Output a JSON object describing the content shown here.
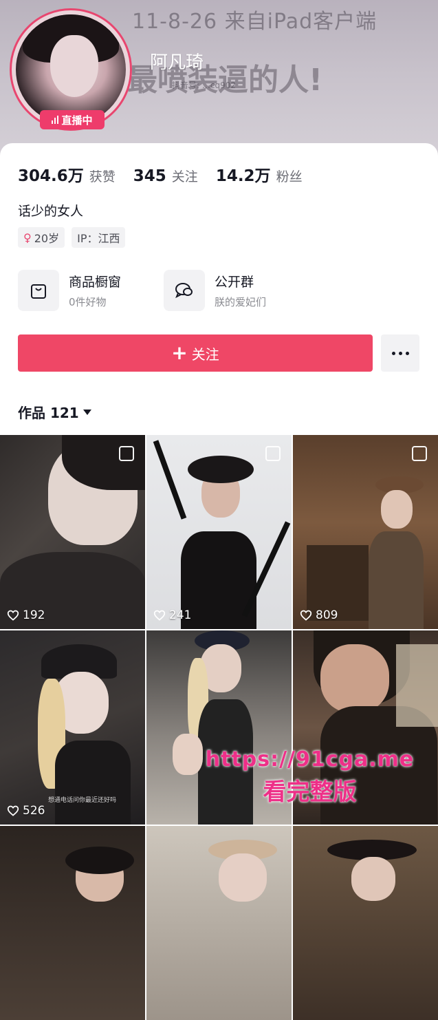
{
  "cover": {
    "line1": "11-8-26  来自iPad客户端",
    "line2": "最喷装逼的人!",
    "line3": "抖音号: …cq902"
  },
  "profile": {
    "nickname": "阿凡琦",
    "live_badge": "直播中",
    "stats": [
      {
        "value": "304.6万",
        "label": "获赞"
      },
      {
        "value": "345",
        "label": "关注"
      },
      {
        "value": "14.2万",
        "label": "粉丝"
      }
    ],
    "bio": "话少的女人",
    "tags": {
      "age": "20岁",
      "ip": "IP：江西"
    },
    "features": [
      {
        "title": "商品橱窗",
        "subtitle": "0件好物",
        "icon": "shopping-bag-icon"
      },
      {
        "title": "公开群",
        "subtitle": "朕的爱妃们",
        "icon": "group-chat-icon"
      }
    ],
    "follow_label": "关注",
    "works_label": "作品 121"
  },
  "grid": {
    "tiles": [
      {
        "likes": "192",
        "caption": ""
      },
      {
        "likes": "241",
        "caption": ""
      },
      {
        "likes": "809",
        "caption": ""
      },
      {
        "likes": "526",
        "caption": "想通电话问你最近还好吗"
      },
      {
        "likes": "",
        "caption": ""
      },
      {
        "likes": "",
        "caption": ""
      },
      {
        "likes": "",
        "caption": ""
      },
      {
        "likes": "",
        "caption": ""
      },
      {
        "likes": "",
        "caption": ""
      }
    ]
  },
  "watermark": {
    "url": "https://91cga.me",
    "text": "看完整版"
  },
  "colors": {
    "accent": "#ef4766",
    "live": "#ee3c6b",
    "watermark": "#ee2f88"
  }
}
